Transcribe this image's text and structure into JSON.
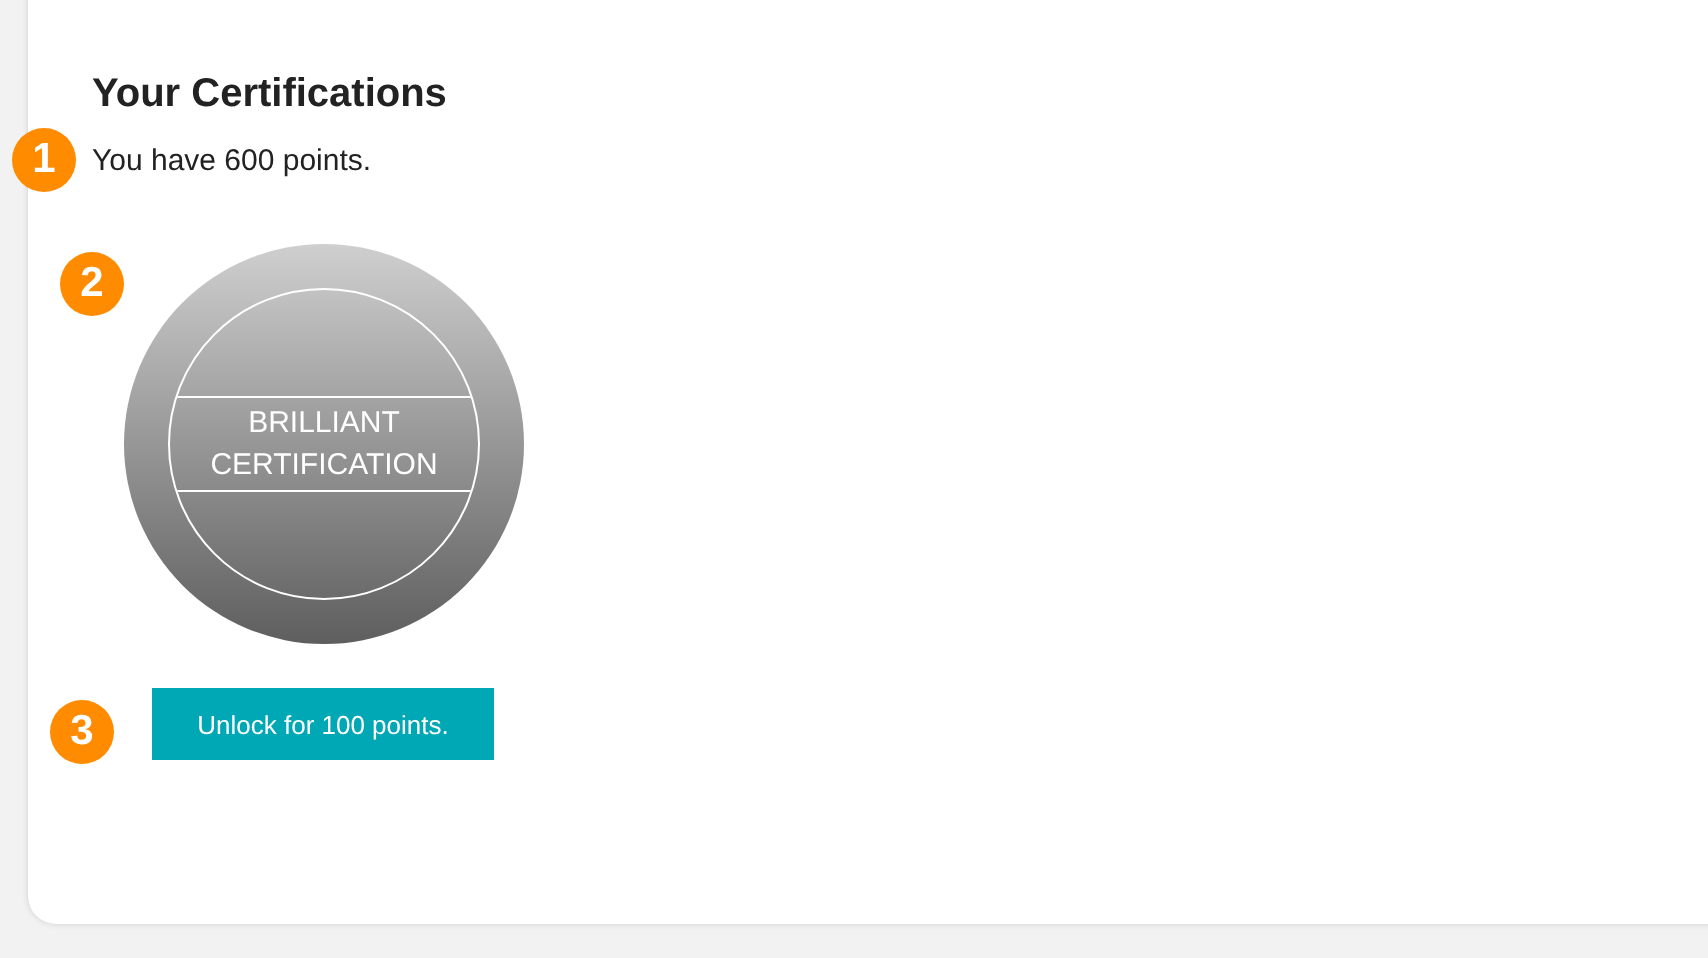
{
  "heading": "Your Certifications",
  "points": {
    "text": "You have 600 points.",
    "marker": "1"
  },
  "certification": {
    "title": "BRILLIANT CERTIFICATION",
    "locked": true,
    "marker": "2"
  },
  "unlock_button": {
    "label": "Unlock for 100 points.",
    "marker": "3"
  }
}
